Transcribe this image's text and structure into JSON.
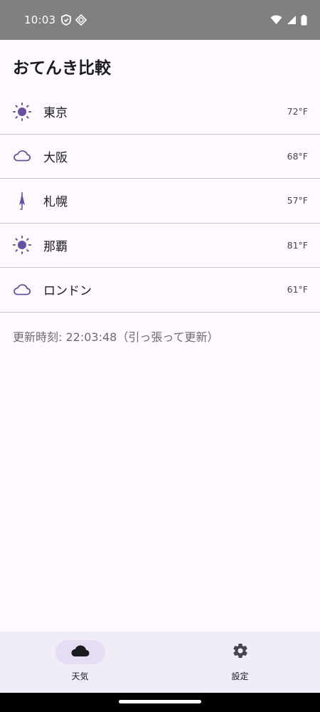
{
  "status_bar": {
    "time": "10:03",
    "icons": [
      "shield-icon",
      "nfc-icon",
      "wifi-icon",
      "signal-icon",
      "battery-icon"
    ]
  },
  "header": {
    "title": "おてんき比較"
  },
  "cities": [
    {
      "name": "東京",
      "temp": "72°F",
      "icon": "sun-icon"
    },
    {
      "name": "大阪",
      "temp": "68°F",
      "icon": "cloud-icon"
    },
    {
      "name": "札幌",
      "temp": "57°F",
      "icon": "umbrella-icon"
    },
    {
      "name": "那覇",
      "temp": "81°F",
      "icon": "sun-icon"
    },
    {
      "name": "ロンドン",
      "temp": "61°F",
      "icon": "cloud-icon"
    }
  ],
  "updated": {
    "text": "更新時刻: 22:03:48（引っ張って更新）"
  },
  "bottom_nav": {
    "items": [
      {
        "label": "天気",
        "icon": "cloud-filled-icon",
        "active": true
      },
      {
        "label": "設定",
        "icon": "gear-icon",
        "active": false
      }
    ]
  },
  "colors": {
    "accent": "#6750a4",
    "background": "#fdf9fe",
    "nav_background": "#f1edf7",
    "nav_active_pill": "#e6ddf5",
    "status_bar": "#808080"
  }
}
